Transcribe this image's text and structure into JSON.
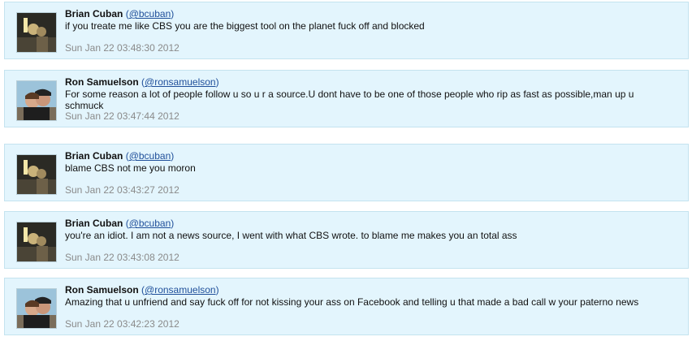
{
  "tweets": [
    {
      "name": "Brian Cuban",
      "handle": "@bcuban",
      "avatar": "brian-cuban-avatar",
      "text": "if you treate me like CBS you are the biggest tool on the planet fuck off and blocked",
      "time": "Sun Jan 22 03:48:30 2012"
    },
    {
      "name": "Ron Samuelson",
      "handle": "@ronsamuelson",
      "avatar": "ron-samuelson-avatar",
      "text": "For some reason a lot of people follow u so u r a source.U dont have to be one of those people who rip as fast as possible,man up u schmuck",
      "time": "Sun Jan 22 03:47:44 2012"
    },
    {
      "name": "Brian Cuban",
      "handle": "@bcuban",
      "avatar": "brian-cuban-avatar",
      "text": "blame CBS not me you moron",
      "time": "Sun Jan 22 03:43:27 2012"
    },
    {
      "name": "Brian Cuban",
      "handle": "@bcuban",
      "avatar": "brian-cuban-avatar",
      "text": "you're an idiot. I am not a news source, I went with what CBS wrote. to blame me makes you an total ass",
      "time": "Sun Jan 22 03:43:08 2012"
    },
    {
      "name": "Ron Samuelson",
      "handle": "@ronsamuelson",
      "avatar": "ron-samuelson-avatar",
      "text": "Amazing that u unfriend and say fuck off for not kissing your ass on Facebook and telling u that made a bad call w your paterno news",
      "time": "Sun Jan 22 03:42:23 2012"
    }
  ],
  "colors": {
    "card_bg": "#e3f5fd",
    "card_border": "#c4e3ef",
    "link": "#1f4f9a",
    "timestamp": "#8a8a8a"
  }
}
